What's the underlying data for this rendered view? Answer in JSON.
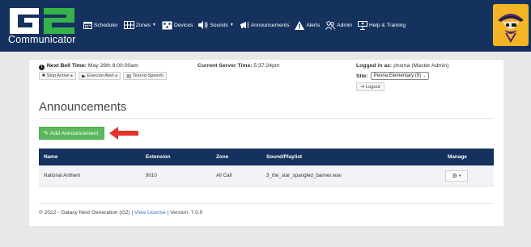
{
  "app": {
    "logo_text": "G2",
    "logo_subtitle": "Communicator"
  },
  "nav": {
    "items": [
      {
        "label": "Scheduler",
        "icon": "calendar-icon",
        "dropdown": false
      },
      {
        "label": "Zones",
        "icon": "zones-grid-icon",
        "dropdown": true
      },
      {
        "label": "Devices",
        "icon": "devices-icon",
        "dropdown": false
      },
      {
        "label": "Sounds",
        "icon": "speaker-icon",
        "dropdown": true
      },
      {
        "label": "Announcements",
        "icon": "megaphone-icon",
        "dropdown": false
      },
      {
        "label": "Alerts",
        "icon": "warning-icon",
        "dropdown": false
      },
      {
        "label": "Admin",
        "icon": "users-icon",
        "dropdown": false
      },
      {
        "label": "Help & Training",
        "icon": "help-person-icon",
        "dropdown": false
      }
    ]
  },
  "status": {
    "next_bell_label": "Next Bell Time:",
    "next_bell_value": "May 26th 8:00:00am",
    "server_time_label": "Current Server Time:",
    "server_time_value": "5:37:24pm",
    "logged_in_label": "Logged in as:",
    "logged_in_value": "phxma (Master Admin)",
    "site_label": "Site:",
    "site_value": "Peoria Elementary (9)",
    "logout_label": "Logout"
  },
  "actions": {
    "stop_active": "Stop Active",
    "execute_alert": "Execute Alert",
    "text_to_speech": "Text-to-Speech"
  },
  "page": {
    "title": "Announcements",
    "add_button": "Add Announcement"
  },
  "table": {
    "headers": [
      "Name",
      "Extension",
      "Zone",
      "Sound/Playlist",
      "Manage"
    ],
    "rows": [
      {
        "name": "National Anthem",
        "extension": "9010",
        "zone": "All Call",
        "sound": "3_the_star_spangled_banner.wav"
      }
    ]
  },
  "footer": {
    "copyright": "© 2022 - Galaxy Next Generation (G2) |",
    "license_link": "View License",
    "version": "| Version: 7.0.0"
  },
  "colors": {
    "navbar": "#15315e",
    "success": "#5cb85c",
    "arrow": "#e5322b",
    "logo_green": "#35b34a",
    "mascot_bg": "#f3b526"
  }
}
